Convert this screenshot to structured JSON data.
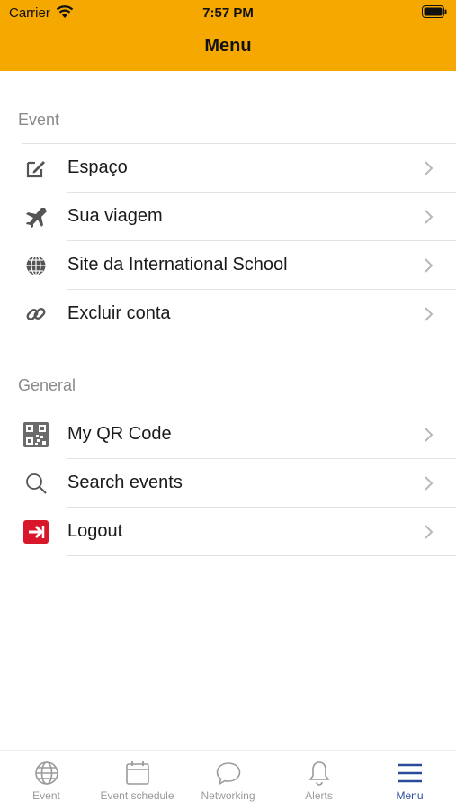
{
  "status": {
    "carrier": "Carrier",
    "time": "7:57 PM"
  },
  "nav": {
    "title": "Menu"
  },
  "sections": {
    "event": {
      "header": "Event",
      "items": [
        {
          "label": "Espaço",
          "icon": "edit-icon"
        },
        {
          "label": "Sua viagem",
          "icon": "airplane-icon"
        },
        {
          "label": "Site da International School",
          "icon": "globe-icon"
        },
        {
          "label": "Excluir conta",
          "icon": "link-icon"
        }
      ]
    },
    "general": {
      "header": "General",
      "items": [
        {
          "label": "My QR Code",
          "icon": "qr-code-icon"
        },
        {
          "label": "Search events",
          "icon": "search-icon"
        },
        {
          "label": "Logout",
          "icon": "logout-icon"
        }
      ]
    }
  },
  "tabs": [
    {
      "label": "Event",
      "icon": "globe-icon"
    },
    {
      "label": "Event schedule",
      "icon": "calendar-icon"
    },
    {
      "label": "Networking",
      "icon": "chat-bubble-icon"
    },
    {
      "label": "Alerts",
      "icon": "bell-icon"
    },
    {
      "label": "Menu",
      "icon": "hamburger-icon",
      "active": true
    }
  ],
  "colors": {
    "header": "#f5a800",
    "active_tab": "#2c4a9a",
    "logout": "#d8182a"
  }
}
